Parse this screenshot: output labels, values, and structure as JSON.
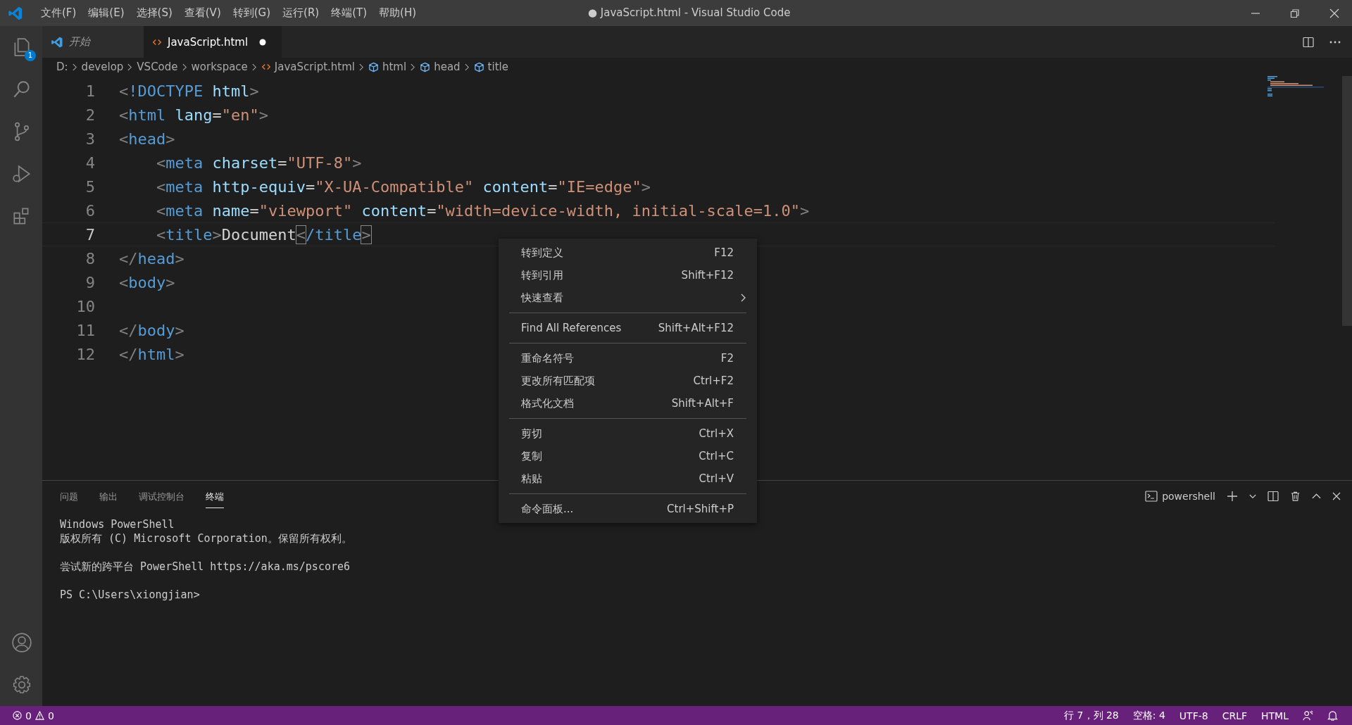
{
  "window": {
    "title": "● JavaScript.html - Visual Studio Code"
  },
  "menu_bar": [
    "文件(F)",
    "编辑(E)",
    "选择(S)",
    "查看(V)",
    "转到(G)",
    "运行(R)",
    "终端(T)",
    "帮助(H)"
  ],
  "activity_bar": {
    "top": [
      {
        "kind": "explorer",
        "selected": false,
        "badge": "1"
      },
      {
        "kind": "search",
        "selected": false
      },
      {
        "kind": "source-control",
        "selected": false
      },
      {
        "kind": "run",
        "selected": false
      },
      {
        "kind": "extensions",
        "selected": false
      }
    ],
    "bottom": [
      {
        "kind": "account",
        "selected": false
      },
      {
        "kind": "settings",
        "selected": false
      }
    ]
  },
  "tabs": [
    {
      "label": "开始",
      "kind": "welcome",
      "selected": false,
      "preview": true,
      "modified": false
    },
    {
      "label": "JavaScript.html",
      "kind": "html",
      "selected": true,
      "preview": false,
      "modified": true
    }
  ],
  "breadcrumb": [
    {
      "label": "D:",
      "kind": "folder"
    },
    {
      "label": "develop",
      "kind": "folder"
    },
    {
      "label": "VSCode",
      "kind": "folder"
    },
    {
      "label": "workspace",
      "kind": "folder"
    },
    {
      "label": "JavaScript.html",
      "kind": "file"
    },
    {
      "label": "html",
      "kind": "symbol"
    },
    {
      "label": "head",
      "kind": "symbol"
    },
    {
      "label": "title",
      "kind": "symbol"
    }
  ],
  "code": [
    {
      "number": "1",
      "current": false,
      "tokens": [
        {
          "kind": "punct",
          "text": "<"
        },
        {
          "kind": "tag",
          "text": "!DOCTYPE"
        },
        {
          "kind": "attr",
          "text": " html"
        },
        {
          "kind": "punct",
          "text": ">"
        }
      ]
    },
    {
      "number": "2",
      "current": false,
      "tokens": [
        {
          "kind": "punct",
          "text": "<"
        },
        {
          "kind": "tag",
          "text": "html"
        },
        {
          "kind": "attr",
          "text": " lang"
        },
        {
          "kind": "text",
          "text": "="
        },
        {
          "kind": "string",
          "text": "\"en\""
        },
        {
          "kind": "punct",
          "text": ">"
        }
      ]
    },
    {
      "number": "3",
      "current": false,
      "tokens": [
        {
          "kind": "punct",
          "text": "<"
        },
        {
          "kind": "tag",
          "text": "head"
        },
        {
          "kind": "punct",
          "text": ">"
        }
      ]
    },
    {
      "number": "4",
      "current": false,
      "tokens": [
        {
          "kind": "punct",
          "text": "    <"
        },
        {
          "kind": "tag",
          "text": "meta"
        },
        {
          "kind": "attr",
          "text": " charset"
        },
        {
          "kind": "text",
          "text": "="
        },
        {
          "kind": "string",
          "text": "\"UTF-8\""
        },
        {
          "kind": "punct",
          "text": ">"
        }
      ]
    },
    {
      "number": "5",
      "current": false,
      "tokens": [
        {
          "kind": "punct",
          "text": "    <"
        },
        {
          "kind": "tag",
          "text": "meta"
        },
        {
          "kind": "attr",
          "text": " http-equiv"
        },
        {
          "kind": "text",
          "text": "="
        },
        {
          "kind": "string",
          "text": "\"X-UA-Compatible\""
        },
        {
          "kind": "attr",
          "text": " content"
        },
        {
          "kind": "text",
          "text": "="
        },
        {
          "kind": "string",
          "text": "\"IE=edge\""
        },
        {
          "kind": "punct",
          "text": ">"
        }
      ]
    },
    {
      "number": "6",
      "current": false,
      "tokens": [
        {
          "kind": "punct",
          "text": "    <"
        },
        {
          "kind": "tag",
          "text": "meta"
        },
        {
          "kind": "attr",
          "text": " name"
        },
        {
          "kind": "text",
          "text": "="
        },
        {
          "kind": "string",
          "text": "\"viewport\""
        },
        {
          "kind": "attr",
          "text": " content"
        },
        {
          "kind": "text",
          "text": "="
        },
        {
          "kind": "string",
          "text": "\"width=device-width, initial-scale=1.0\""
        },
        {
          "kind": "punct",
          "text": ">"
        }
      ]
    },
    {
      "number": "7",
      "current": true,
      "tokens": [
        {
          "kind": "punct",
          "text": "    <"
        },
        {
          "kind": "tag",
          "text": "title"
        },
        {
          "kind": "punct",
          "text": ">"
        },
        {
          "kind": "text",
          "text": "Document"
        },
        {
          "kind": "match",
          "text": "<"
        },
        {
          "kind": "tag",
          "text": "/title"
        },
        {
          "kind": "match",
          "text": ">"
        }
      ]
    },
    {
      "number": "8",
      "current": false,
      "tokens": [
        {
          "kind": "punct",
          "text": "</"
        },
        {
          "kind": "tag",
          "text": "head"
        },
        {
          "kind": "punct",
          "text": ">"
        }
      ]
    },
    {
      "number": "9",
      "current": false,
      "tokens": [
        {
          "kind": "punct",
          "text": "<"
        },
        {
          "kind": "tag",
          "text": "body"
        },
        {
          "kind": "punct",
          "text": ">"
        }
      ]
    },
    {
      "number": "10",
      "current": false
    },
    {
      "number": "11",
      "current": false,
      "tokens": [
        {
          "kind": "punct",
          "text": "</"
        },
        {
          "kind": "tag",
          "text": "body"
        },
        {
          "kind": "punct",
          "text": ">"
        }
      ]
    },
    {
      "number": "12",
      "current": false,
      "tokens": [
        {
          "kind": "punct",
          "text": "</"
        },
        {
          "kind": "tag",
          "text": "html"
        },
        {
          "kind": "punct",
          "text": ">"
        }
      ]
    }
  ],
  "context_menu": {
    "groups": [
      [
        {
          "label": "转到定义",
          "shortcut": "F12",
          "submenu": false
        },
        {
          "label": "转到引用",
          "shortcut": "Shift+F12",
          "submenu": false
        },
        {
          "label": "快速查看",
          "submenu": true
        }
      ],
      [
        {
          "label": "Find All References",
          "shortcut": "Shift+Alt+F12",
          "submenu": false
        }
      ],
      [
        {
          "label": "重命名符号",
          "shortcut": "F2",
          "submenu": false
        },
        {
          "label": "更改所有匹配项",
          "shortcut": "Ctrl+F2",
          "submenu": false
        },
        {
          "label": "格式化文档",
          "shortcut": "Shift+Alt+F",
          "submenu": false
        }
      ],
      [
        {
          "label": "剪切",
          "shortcut": "Ctrl+X",
          "submenu": false
        },
        {
          "label": "复制",
          "shortcut": "Ctrl+C",
          "submenu": false
        },
        {
          "label": "粘贴",
          "shortcut": "Ctrl+V",
          "submenu": false
        }
      ],
      [
        {
          "label": "命令面板...",
          "shortcut": "Ctrl+Shift+P",
          "submenu": false
        }
      ]
    ]
  },
  "panel": {
    "tabs": [
      {
        "label": "问题",
        "selected": false
      },
      {
        "label": "输出",
        "selected": false
      },
      {
        "label": "调试控制台",
        "selected": false
      },
      {
        "label": "终端",
        "selected": true
      }
    ],
    "terminal_name": "powershell",
    "terminal": [
      [
        "Windows PowerShell",
        "版权所有 (C) Microsoft Corporation。保留所有权利。"
      ],
      [
        "尝试新的跨平台 PowerShell https://aka.ms/pscore6"
      ],
      [
        "PS C:\\Users\\xiongjian>"
      ]
    ]
  },
  "status_bar": {
    "errors": "0",
    "warnings": "0",
    "items": [
      "行 7，列 28",
      "空格: 4",
      "UTF-8",
      "CRLF",
      "HTML"
    ]
  }
}
